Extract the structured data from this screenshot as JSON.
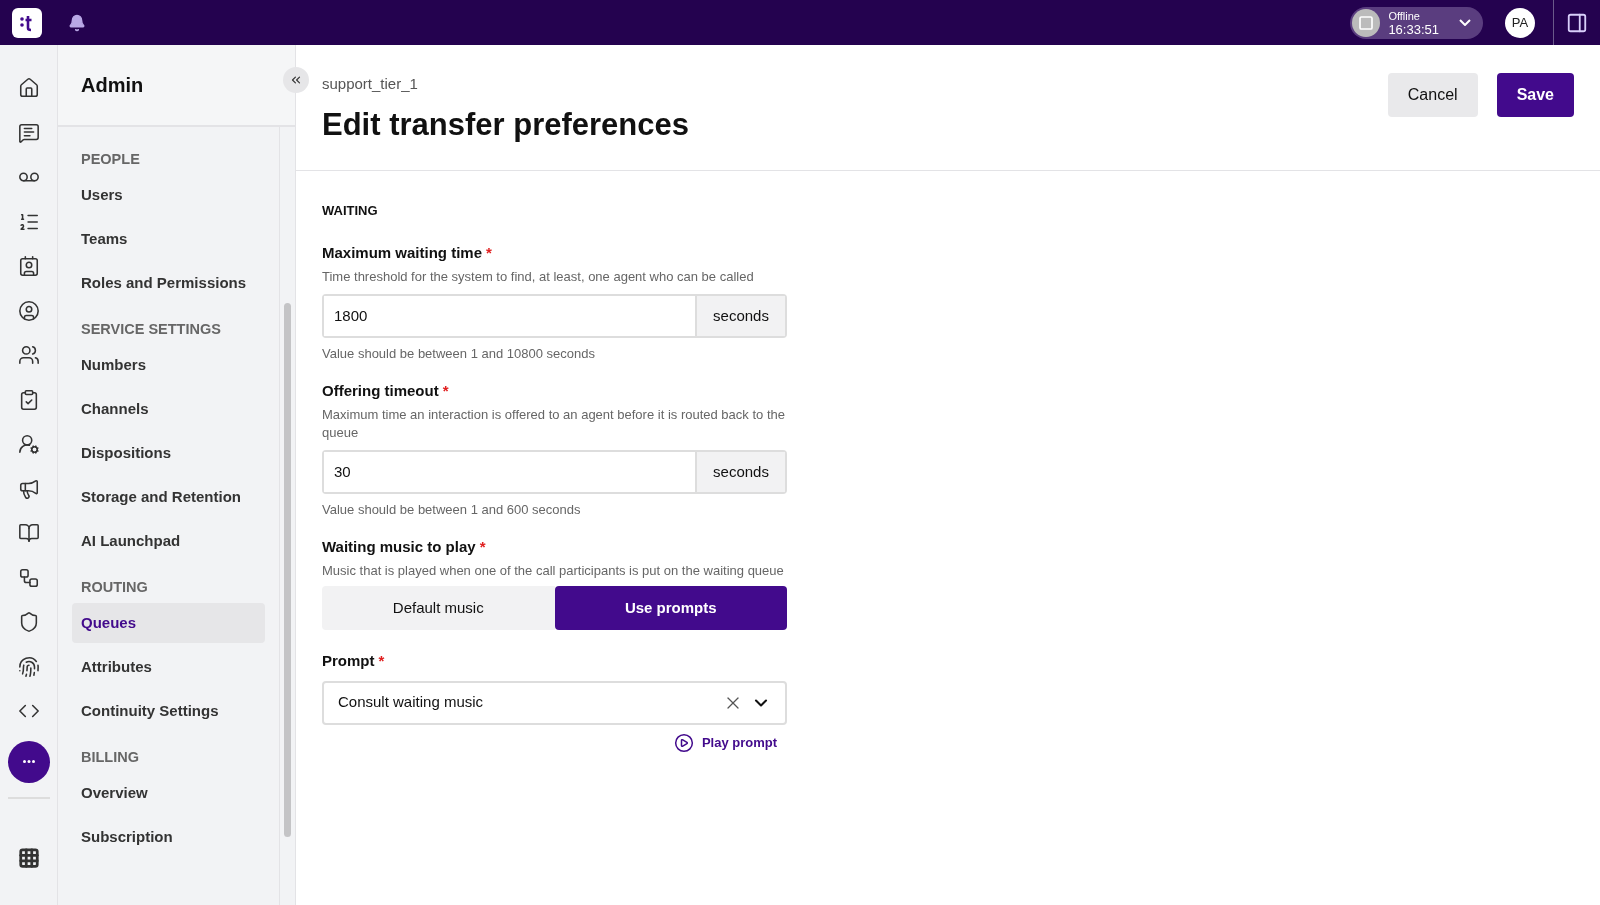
{
  "topbar": {
    "status": "Offline",
    "time": "16:33:51",
    "avatar": "PA"
  },
  "sidebar": {
    "title": "Admin",
    "sections": [
      {
        "heading": "PEOPLE",
        "items": [
          {
            "label": "Users",
            "selected": false
          },
          {
            "label": "Teams",
            "selected": false
          },
          {
            "label": "Roles and Permissions",
            "selected": false
          }
        ]
      },
      {
        "heading": "SERVICE SETTINGS",
        "items": [
          {
            "label": "Numbers",
            "selected": false
          },
          {
            "label": "Channels",
            "selected": false
          },
          {
            "label": "Dispositions",
            "selected": false
          },
          {
            "label": "Storage and Retention",
            "selected": false
          },
          {
            "label": "AI Launchpad",
            "selected": false
          }
        ]
      },
      {
        "heading": "ROUTING",
        "items": [
          {
            "label": "Queues",
            "selected": true
          },
          {
            "label": "Attributes",
            "selected": false
          },
          {
            "label": "Continuity Settings",
            "selected": false
          }
        ]
      },
      {
        "heading": "BILLING",
        "items": [
          {
            "label": "Overview",
            "selected": false
          },
          {
            "label": "Subscription",
            "selected": false
          }
        ]
      }
    ]
  },
  "header": {
    "breadcrumb": "support_tier_1",
    "title": "Edit transfer preferences",
    "buttons": [
      {
        "label": "Cancel",
        "kind": "secondary"
      },
      {
        "label": "Save",
        "kind": "primary"
      }
    ]
  },
  "section": "WAITING",
  "fields": [
    {
      "kind": "number",
      "label": "Maximum waiting time",
      "required_mark": "*",
      "description": "Time threshold for the system to find, at least, one agent who can be called",
      "value": "1800",
      "unit": "seconds",
      "hint": "Value should be between 1 and 10800 seconds"
    },
    {
      "kind": "number",
      "label": "Offering timeout",
      "required_mark": "*",
      "description": "Maximum time an interaction is offered to an agent before it is routed back to the queue",
      "value": "30",
      "unit": "seconds",
      "hint": "Value should be between 1 and 600 seconds"
    },
    {
      "kind": "toggle",
      "label": "Waiting music to play",
      "required_mark": "*",
      "description": "Music that is played when one of the call participants is put on the waiting queue",
      "options": [
        {
          "label": "Default music",
          "selected": false
        },
        {
          "label": "Use prompts",
          "selected": true
        }
      ]
    },
    {
      "kind": "select",
      "label": "Prompt",
      "required_mark": "*",
      "value": "Consult waiting music",
      "action": "Play prompt"
    }
  ]
}
